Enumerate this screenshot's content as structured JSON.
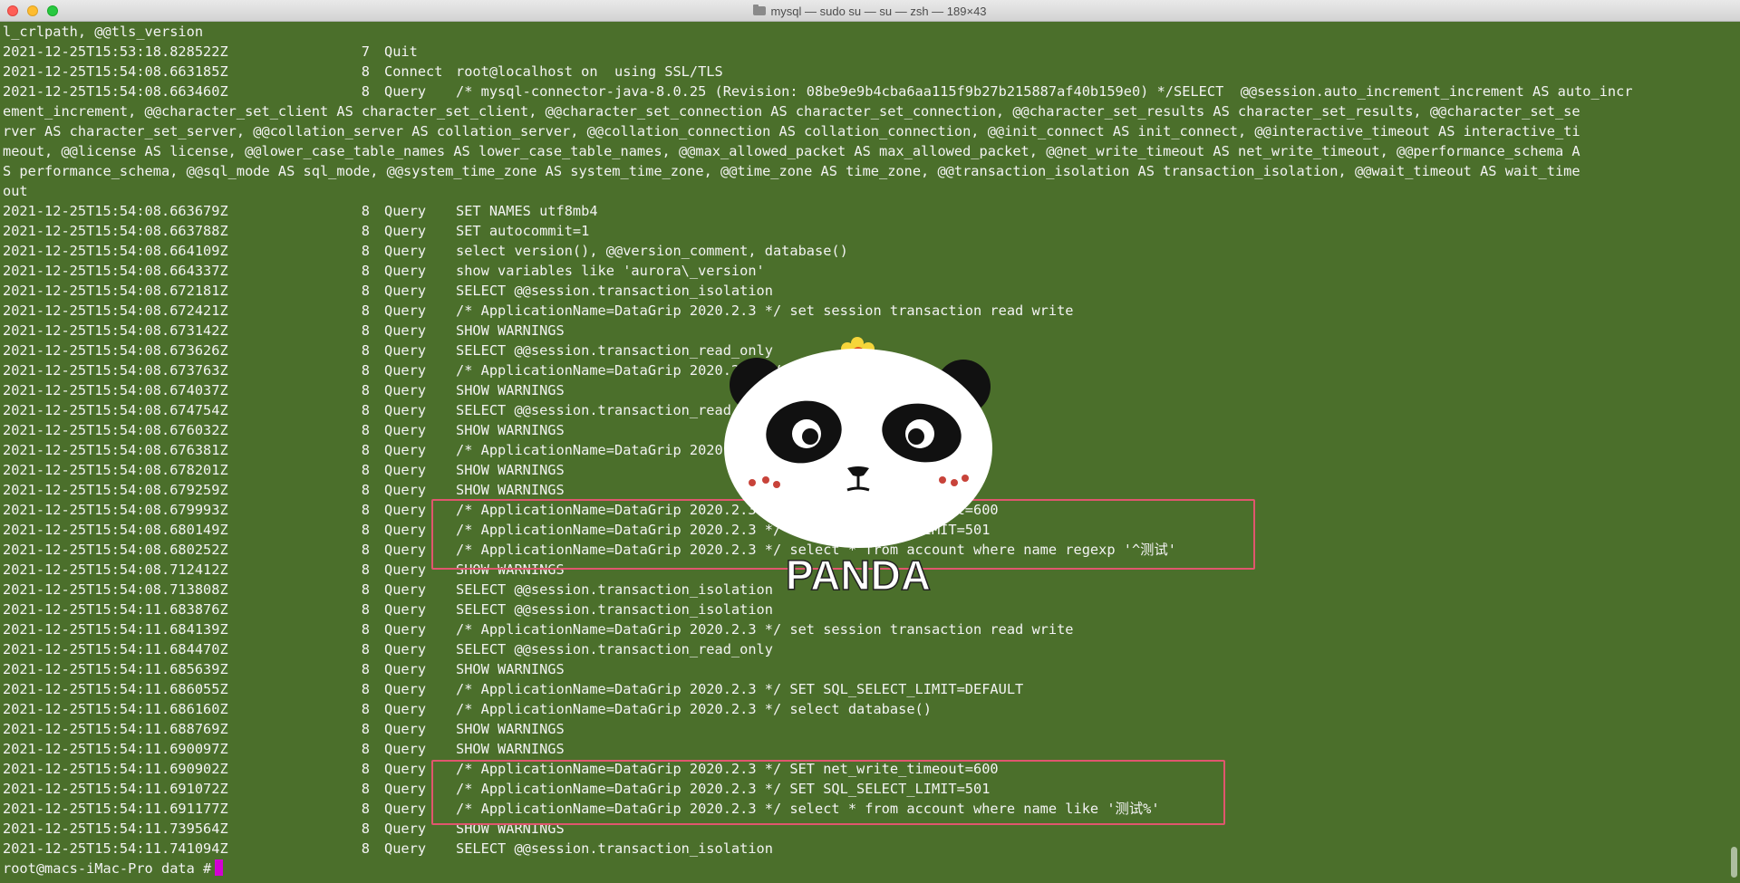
{
  "window": {
    "title": "mysql — sudo su — su — zsh — 189×43"
  },
  "terminal": {
    "wrapped_lines": [
      "l_crlpath, @@tls_version"
    ],
    "rows_top": [
      {
        "ts": "2021-12-25T15:53:18.828522Z",
        "id": "7",
        "cmd": "Quit",
        "arg": ""
      },
      {
        "ts": "2021-12-25T15:54:08.663185Z",
        "id": "8",
        "cmd": "Connect",
        "arg": "root@localhost on  using SSL/TLS"
      },
      {
        "ts": "2021-12-25T15:54:08.663460Z",
        "id": "8",
        "cmd": "Query",
        "arg": "/* mysql-connector-java-8.0.25 (Revision: 08be9e9b4cba6aa115f9b27b215887af40b159e0) */SELECT  @@session.auto_increment_increment AS auto_incr"
      }
    ],
    "wrapped_continuation": [
      "ement_increment, @@character_set_client AS character_set_client, @@character_set_connection AS character_set_connection, @@character_set_results AS character_set_results, @@character_set_se",
      "rver AS character_set_server, @@collation_server AS collation_server, @@collation_connection AS collation_connection, @@init_connect AS init_connect, @@interactive_timeout AS interactive_ti",
      "meout, @@license AS license, @@lower_case_table_names AS lower_case_table_names, @@max_allowed_packet AS max_allowed_packet, @@net_write_timeout AS net_write_timeout, @@performance_schema A",
      "S performance_schema, @@sql_mode AS sql_mode, @@system_time_zone AS system_time_zone, @@time_zone AS time_zone, @@transaction_isolation AS transaction_isolation, @@wait_timeout AS wait_time",
      "out"
    ],
    "rows": [
      {
        "ts": "2021-12-25T15:54:08.663679Z",
        "id": "8",
        "cmd": "Query",
        "arg": "SET NAMES utf8mb4"
      },
      {
        "ts": "2021-12-25T15:54:08.663788Z",
        "id": "8",
        "cmd": "Query",
        "arg": "SET autocommit=1"
      },
      {
        "ts": "2021-12-25T15:54:08.664109Z",
        "id": "8",
        "cmd": "Query",
        "arg": "select version(), @@version_comment, database()"
      },
      {
        "ts": "2021-12-25T15:54:08.664337Z",
        "id": "8",
        "cmd": "Query",
        "arg": "show variables like 'aurora\\_version'"
      },
      {
        "ts": "2021-12-25T15:54:08.672181Z",
        "id": "8",
        "cmd": "Query",
        "arg": "SELECT @@session.transaction_isolation"
      },
      {
        "ts": "2021-12-25T15:54:08.672421Z",
        "id": "8",
        "cmd": "Query",
        "arg": "/* ApplicationName=DataGrip 2020.2.3 */ set session transaction read write"
      },
      {
        "ts": "2021-12-25T15:54:08.673142Z",
        "id": "8",
        "cmd": "Query",
        "arg": "SHOW WARNINGS"
      },
      {
        "ts": "2021-12-25T15:54:08.673626Z",
        "id": "8",
        "cmd": "Query",
        "arg": "SELECT @@session.transaction_read_only"
      },
      {
        "ts": "2021-12-25T15:54:08.673763Z",
        "id": "8",
        "cmd": "Query",
        "arg": "/* ApplicationName=DataGrip 2020.2.3 */ use myemployees"
      },
      {
        "ts": "2021-12-25T15:54:08.674037Z",
        "id": "8",
        "cmd": "Query",
        "arg": "SHOW WARNINGS"
      },
      {
        "ts": "2021-12-25T15:54:08.674754Z",
        "id": "8",
        "cmd": "Query",
        "arg": "SELECT @@session.transaction_read_only"
      },
      {
        "ts": "2021-12-25T15:54:08.676032Z",
        "id": "8",
        "cmd": "Query",
        "arg": "SHOW WARNINGS"
      },
      {
        "ts": "2021-12-25T15:54:08.676381Z",
        "id": "8",
        "cmd": "Query",
        "arg": "/* ApplicationName=DataGrip 2020.2.3 */ select database()"
      },
      {
        "ts": "2021-12-25T15:54:08.678201Z",
        "id": "8",
        "cmd": "Query",
        "arg": "SHOW WARNINGS"
      },
      {
        "ts": "2021-12-25T15:54:08.679259Z",
        "id": "8",
        "cmd": "Query",
        "arg": "SHOW WARNINGS"
      },
      {
        "ts": "2021-12-25T15:54:08.679993Z",
        "id": "8",
        "cmd": "Query",
        "arg": "/* ApplicationName=DataGrip 2020.2.3 */ SET net_write_timeout=600"
      },
      {
        "ts": "2021-12-25T15:54:08.680149Z",
        "id": "8",
        "cmd": "Query",
        "arg": "/* ApplicationName=DataGrip 2020.2.3 */ SET SQL_SELECT_LIMIT=501"
      },
      {
        "ts": "2021-12-25T15:54:08.680252Z",
        "id": "8",
        "cmd": "Query",
        "arg": "/* ApplicationName=DataGrip 2020.2.3 */ select * from account where name regexp '^测试'"
      },
      {
        "ts": "2021-12-25T15:54:08.712412Z",
        "id": "8",
        "cmd": "Query",
        "arg": "SHOW WARNINGS"
      },
      {
        "ts": "2021-12-25T15:54:08.713808Z",
        "id": "8",
        "cmd": "Query",
        "arg": "SELECT @@session.transaction_isolation"
      },
      {
        "ts": "2021-12-25T15:54:11.683876Z",
        "id": "8",
        "cmd": "Query",
        "arg": "SELECT @@session.transaction_isolation"
      },
      {
        "ts": "2021-12-25T15:54:11.684139Z",
        "id": "8",
        "cmd": "Query",
        "arg": "/* ApplicationName=DataGrip 2020.2.3 */ set session transaction read write"
      },
      {
        "ts": "2021-12-25T15:54:11.684470Z",
        "id": "8",
        "cmd": "Query",
        "arg": "SELECT @@session.transaction_read_only"
      },
      {
        "ts": "2021-12-25T15:54:11.685639Z",
        "id": "8",
        "cmd": "Query",
        "arg": "SHOW WARNINGS"
      },
      {
        "ts": "2021-12-25T15:54:11.686055Z",
        "id": "8",
        "cmd": "Query",
        "arg": "/* ApplicationName=DataGrip 2020.2.3 */ SET SQL_SELECT_LIMIT=DEFAULT"
      },
      {
        "ts": "2021-12-25T15:54:11.686160Z",
        "id": "8",
        "cmd": "Query",
        "arg": "/* ApplicationName=DataGrip 2020.2.3 */ select database()"
      },
      {
        "ts": "2021-12-25T15:54:11.688769Z",
        "id": "8",
        "cmd": "Query",
        "arg": "SHOW WARNINGS"
      },
      {
        "ts": "2021-12-25T15:54:11.690097Z",
        "id": "8",
        "cmd": "Query",
        "arg": "SHOW WARNINGS"
      },
      {
        "ts": "2021-12-25T15:54:11.690902Z",
        "id": "8",
        "cmd": "Query",
        "arg": "/* ApplicationName=DataGrip 2020.2.3 */ SET net_write_timeout=600"
      },
      {
        "ts": "2021-12-25T15:54:11.691072Z",
        "id": "8",
        "cmd": "Query",
        "arg": "/* ApplicationName=DataGrip 2020.2.3 */ SET SQL_SELECT_LIMIT=501"
      },
      {
        "ts": "2021-12-25T15:54:11.691177Z",
        "id": "8",
        "cmd": "Query",
        "arg": "/* ApplicationName=DataGrip 2020.2.3 */ select * from account where name like '测试%'"
      },
      {
        "ts": "2021-12-25T15:54:11.739564Z",
        "id": "8",
        "cmd": "Query",
        "arg": "SHOW WARNINGS"
      },
      {
        "ts": "2021-12-25T15:54:11.741094Z",
        "id": "8",
        "cmd": "Query",
        "arg": "SELECT @@session.transaction_isolation"
      }
    ],
    "prompt": "root@macs-iMac-Pro data #"
  },
  "sticker": {
    "text": "PANDA"
  },
  "colors": {
    "background": "#4b6f2b",
    "text": "#f3f3f3",
    "highlight_border": "#e0566e",
    "cursor": "#d200d2"
  }
}
